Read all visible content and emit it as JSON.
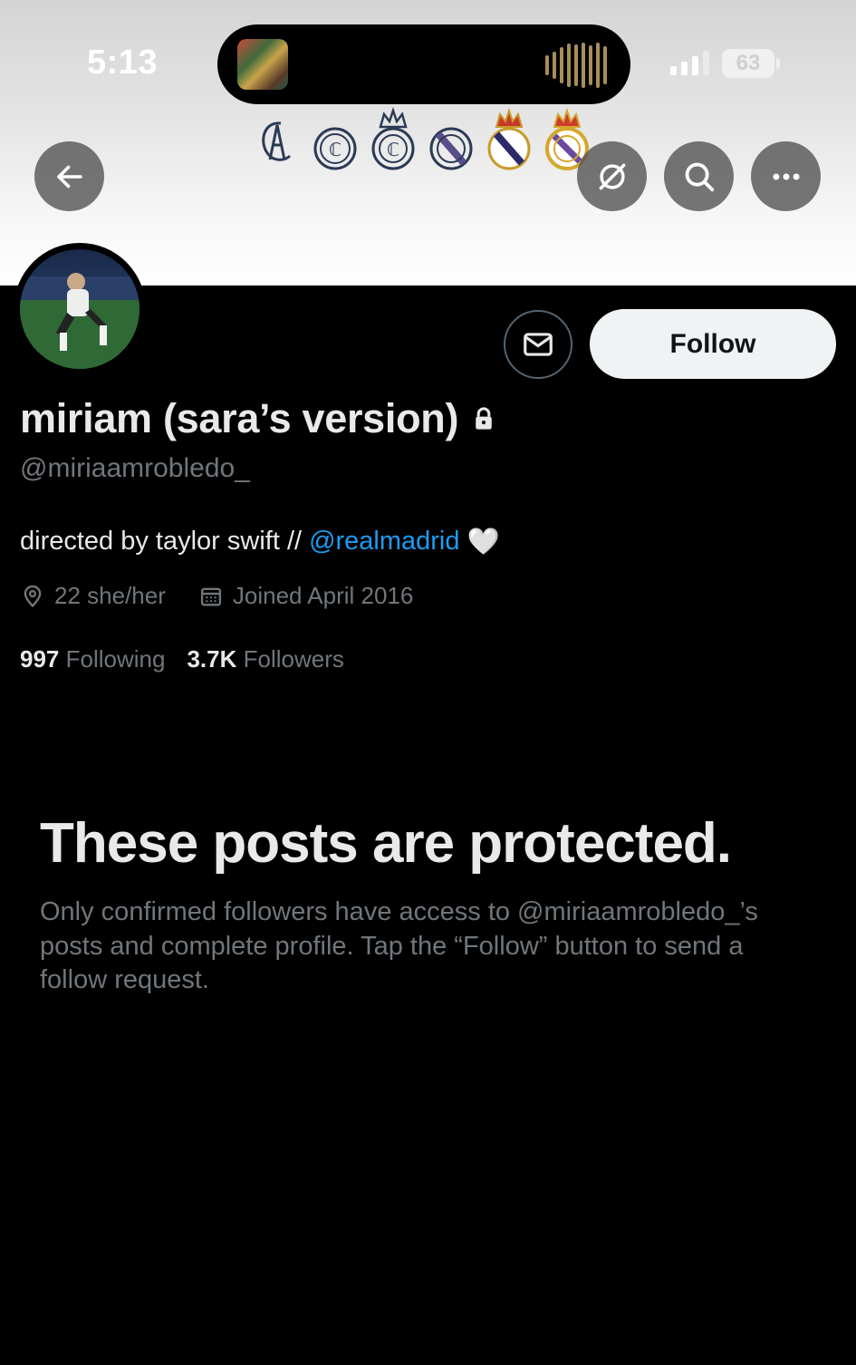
{
  "status_bar": {
    "time": "5:13",
    "battery": "63",
    "signal_bars": 3
  },
  "header": {
    "back_icon": "arrow-left-icon",
    "translate_icon": "no-translate-icon",
    "search_icon": "search-icon",
    "more_icon": "more-horizontal-icon"
  },
  "profile": {
    "display_name": "miriam (sara’s version)",
    "protected_icon": "lock-icon",
    "handle": "@miriaamrobledo_",
    "bio_text": "directed by taylor swift //",
    "bio_mention": "@realmadrid",
    "bio_emoji": "🤍",
    "location": "22 she/her",
    "joined": "Joined April 2016",
    "following_count": "997",
    "following_label": "Following",
    "followers_count": "3.7K",
    "followers_label": "Followers"
  },
  "actions": {
    "message_icon": "envelope-icon",
    "follow_label": "Follow"
  },
  "protected_notice": {
    "title": "These posts are protected.",
    "body": "Only confirmed followers have access to @miriaamrobledo_’s posts and complete profile. Tap the “Follow” button to send a follow request."
  },
  "colors": {
    "background": "#000000",
    "primary_text": "#e7e9ea",
    "secondary_text": "#71767b",
    "link": "#1d9bf0",
    "follow_button_bg": "#eff3f4"
  }
}
